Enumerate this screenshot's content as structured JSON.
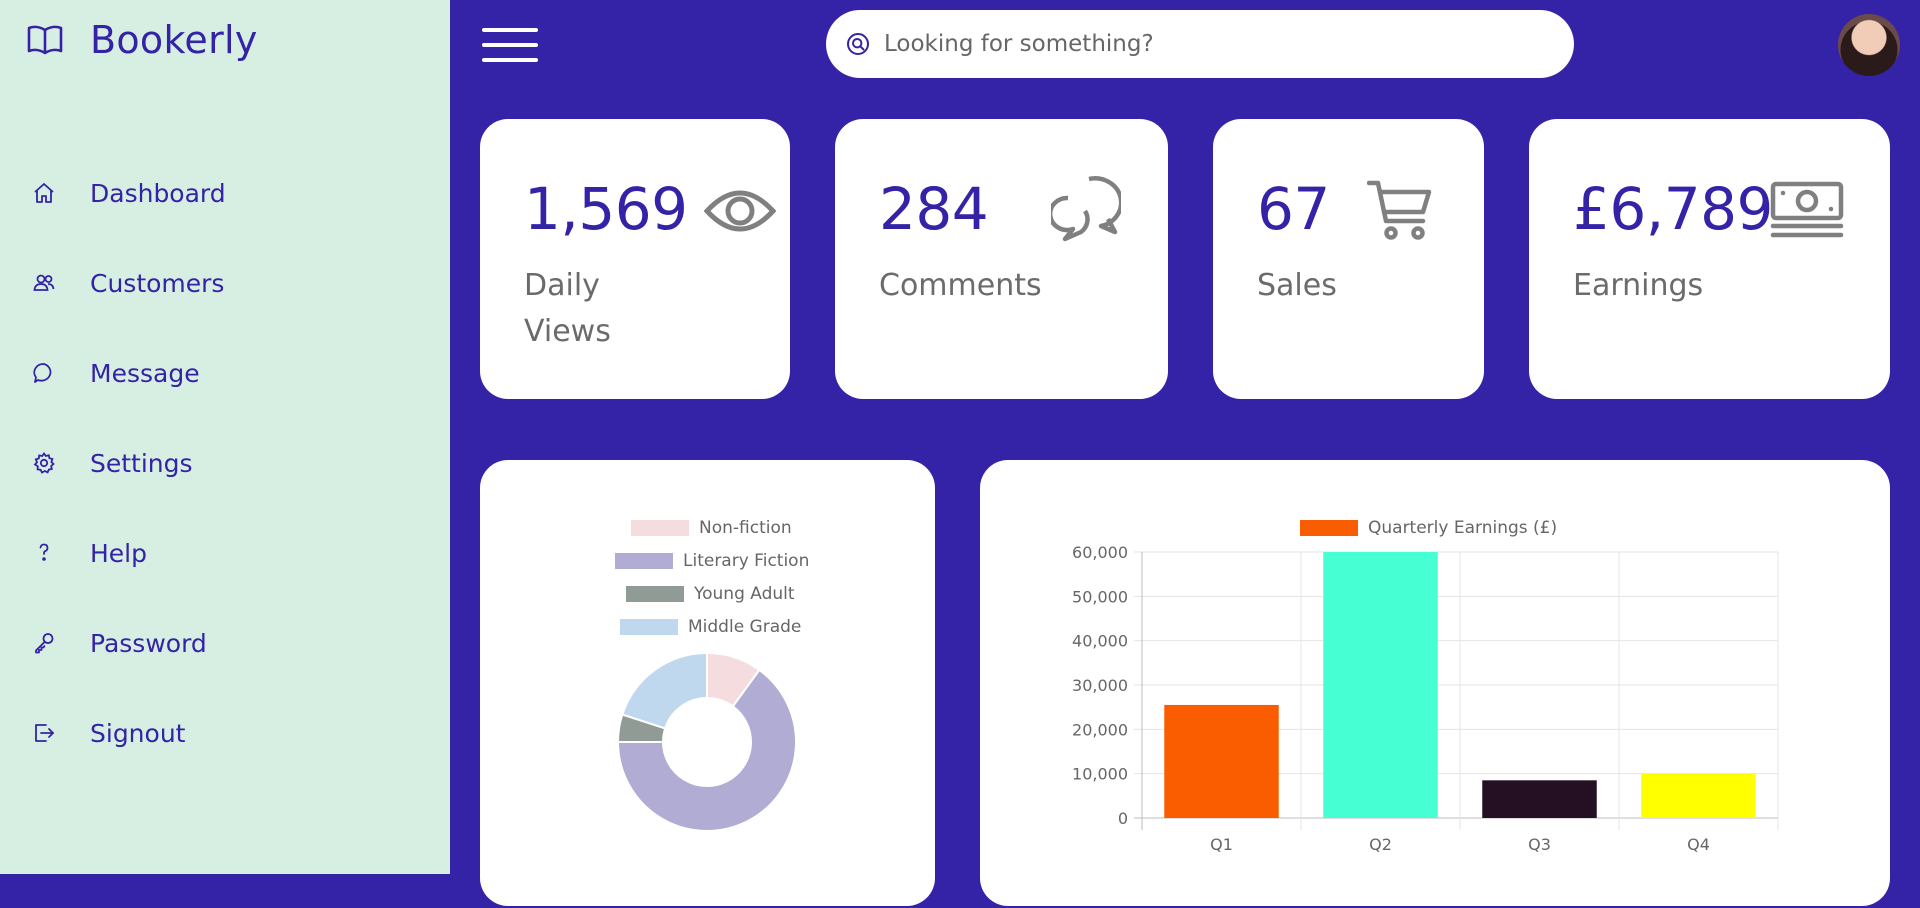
{
  "brand": {
    "title": "Bookerly",
    "icon": "book-open-icon"
  },
  "sidebar": {
    "items": [
      {
        "label": "Dashboard",
        "icon": "home-icon"
      },
      {
        "label": "Customers",
        "icon": "users-icon"
      },
      {
        "label": "Message",
        "icon": "chat-icon"
      },
      {
        "label": "Settings",
        "icon": "gear-icon"
      },
      {
        "label": "Help",
        "icon": "question-icon"
      },
      {
        "label": "Password",
        "icon": "key-icon"
      },
      {
        "label": "Signout",
        "icon": "signout-icon"
      }
    ]
  },
  "search": {
    "placeholder": "Looking for something?"
  },
  "cards": [
    {
      "value": "1,569",
      "label": "Daily Views",
      "label_line1": "Daily",
      "label_line2": "Views",
      "icon": "eye-icon"
    },
    {
      "value": "284",
      "label": "Comments",
      "icon": "comments-icon"
    },
    {
      "value": "67",
      "label": "Sales",
      "icon": "cart-icon"
    },
    {
      "value": "£6,789",
      "label": "Earnings",
      "icon": "money-icon"
    }
  ],
  "colors": {
    "primary": "#3423a6",
    "sidebar_bg": "#d7efe3",
    "card_bg": "#ffffff",
    "icon_gray": "#808080"
  },
  "chart_data": [
    {
      "type": "pie",
      "variant": "doughnut",
      "categories": [
        "Non-fiction",
        "Literary Fiction",
        "Young Adult",
        "Middle Grade"
      ],
      "values": [
        10,
        65,
        5,
        20
      ],
      "colors": [
        "#f4dcdf",
        "#b1acd3",
        "#919b95",
        "#bfd8ee"
      ],
      "legend": "top"
    },
    {
      "type": "bar",
      "categories": [
        "Q1",
        "Q2",
        "Q3",
        "Q4"
      ],
      "series": [
        {
          "name": "Quarterly Earnings (£)",
          "values": [
            25500,
            60000,
            8500,
            10000
          ]
        }
      ],
      "colors": [
        "#fa5c00",
        "#46ffd2",
        "#241022",
        "#ffff00"
      ],
      "legend_color": "#fa5c00",
      "ylim": [
        0,
        60000
      ],
      "yticks": [
        0,
        10000,
        20000,
        30000,
        40000,
        50000,
        60000
      ],
      "ytick_labels": [
        "0",
        "10,000",
        "20,000",
        "30,000",
        "40,000",
        "50,000",
        "60,000"
      ],
      "grid": true,
      "legend": "top"
    }
  ]
}
